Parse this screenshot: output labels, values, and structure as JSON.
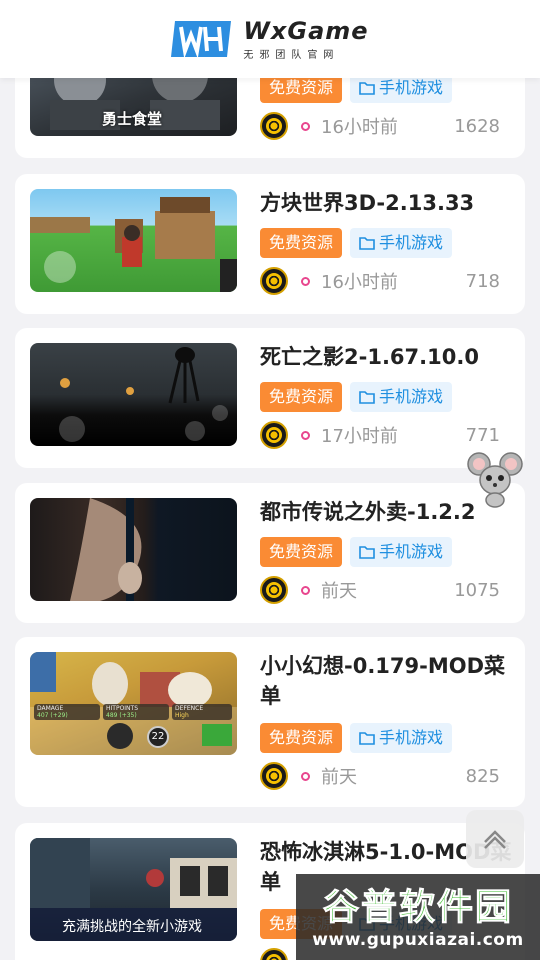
{
  "header": {
    "logo_title": "WxGame",
    "logo_sub": "无邪团队官网",
    "brand_color": "#2d8ee0"
  },
  "tags": {
    "free_label": "免费资源",
    "category_label": "手机游戏",
    "free_color": "#fa8b34",
    "category_color": "#1f8fe0"
  },
  "items": [
    {
      "title": "",
      "time": "16小时前",
      "count": "1628",
      "thumb_caption": "勇士食堂"
    },
    {
      "title": "方块世界3D-2.13.33",
      "time": "16小时前",
      "count": "718"
    },
    {
      "title": "死亡之影2-1.67.10.0",
      "time": "17小时前",
      "count": "771"
    },
    {
      "title": "都市传说之外卖-1.2.2",
      "time": "前天",
      "count": "1075"
    },
    {
      "title": "小小幻想-0.179-MOD菜单",
      "time": "前天",
      "count": "825",
      "stats": [
        {
          "label": "DAMAGE",
          "value": "407 (+29)"
        },
        {
          "label": "HITPOINTS",
          "value": "489 (+35)"
        },
        {
          "label": "DEFENCE",
          "value": "High"
        }
      ],
      "badge_number": "22"
    },
    {
      "title": "恐怖冰淇淋5-1.0-MOD菜单",
      "time": "",
      "count": "",
      "thumb_caption": "充满挑战的全新小游戏"
    }
  ],
  "watermark": {
    "title": "谷普软件园",
    "url": "www.gupuxiazai.com"
  }
}
